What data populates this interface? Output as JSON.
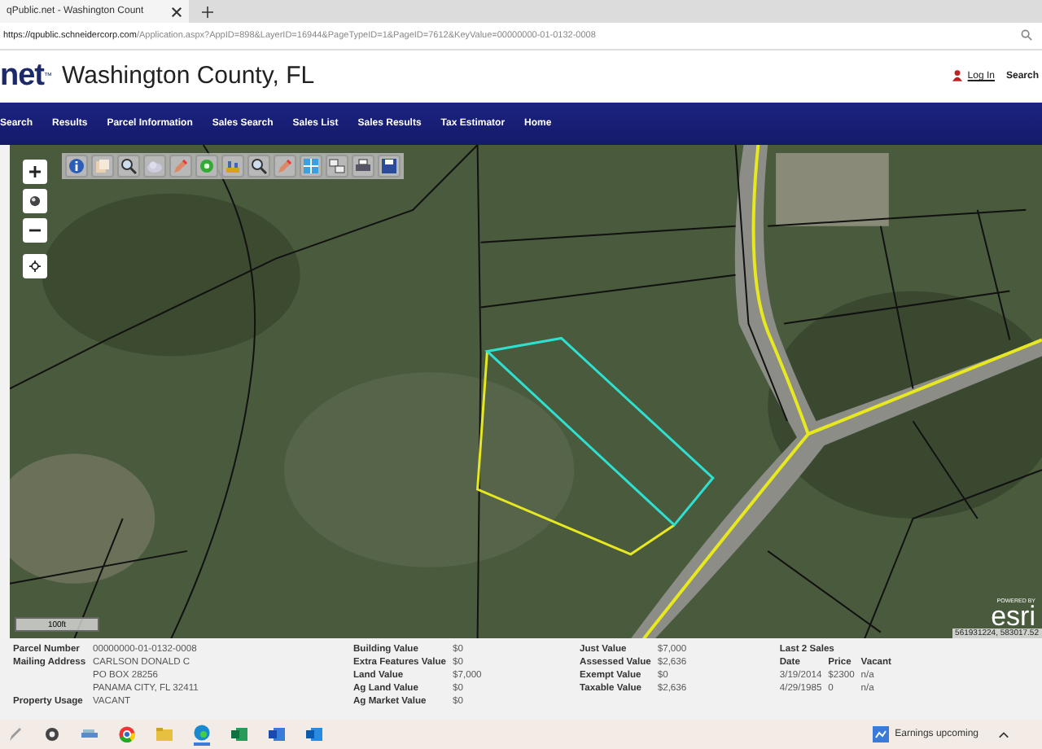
{
  "browser": {
    "tab_title": "qPublic.net - Washington Count",
    "url_host": "https://qpublic.schneidercorp.com",
    "url_path": "/Application.aspx?AppID=898&LayerID=16944&PageTypeID=1&PageID=7612&KeyValue=00000000-01-0132-0008"
  },
  "header": {
    "logo": "net",
    "trademark": "™",
    "title": "Washington County, FL",
    "login": "Log In",
    "search": "Search"
  },
  "nav": [
    {
      "label": "Search"
    },
    {
      "label": "Results"
    },
    {
      "label": "Parcel Information"
    },
    {
      "label": "Sales Search"
    },
    {
      "label": "Sales List"
    },
    {
      "label": "Sales Results"
    },
    {
      "label": "Tax Estimator"
    },
    {
      "label": "Home"
    }
  ],
  "map": {
    "scale": "100ft",
    "powered_by": "POWERED BY",
    "logo": "esri",
    "coordinates": "561931224, 583017.52"
  },
  "parcel": [
    {
      "label": "Parcel Number",
      "lines": [
        "00000000-01-0132-0008"
      ]
    },
    {
      "label": "Mailing Address",
      "lines": [
        "CARLSON DONALD C",
        "PO BOX 28256",
        "PANAMA CITY, FL 32411"
      ]
    },
    {
      "label": "Property Usage",
      "lines": [
        "VACANT"
      ]
    }
  ],
  "values": [
    {
      "label": "Building Value",
      "value": "$0"
    },
    {
      "label": "Extra Features Value",
      "value": "$0"
    },
    {
      "label": "Land Value",
      "value": "$7,000"
    },
    {
      "label": "Ag Land Value",
      "value": "$0"
    },
    {
      "label": "Ag Market Value",
      "value": "$0"
    }
  ],
  "taxes": [
    {
      "label": "Just Value",
      "value": "$7,000"
    },
    {
      "label": "Assessed Value",
      "value": "$2,636"
    },
    {
      "label": "Exempt Value",
      "value": "$0"
    },
    {
      "label": "Taxable Value",
      "value": "$2,636"
    }
  ],
  "sales": {
    "title": "Last 2 Sales",
    "columns": [
      "Date",
      "Price",
      "Vacant"
    ],
    "rows": [
      [
        "3/19/2014",
        "$2300",
        "n/a"
      ],
      [
        "4/29/1985",
        "0",
        "n/a"
      ]
    ]
  },
  "taskbar": {
    "news": "Earnings upcoming"
  }
}
